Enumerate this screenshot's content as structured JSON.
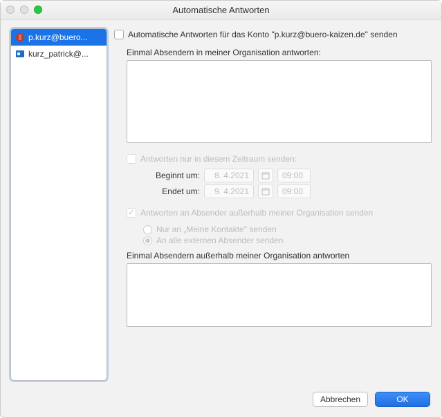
{
  "window": {
    "title": "Automatische Antworten"
  },
  "accounts": [
    {
      "label": "p.kurz@buero...",
      "icon": "outlook-badge-red",
      "selected": true
    },
    {
      "label": "kurz_patrick@...",
      "icon": "outlook-badge-blue",
      "selected": false
    }
  ],
  "send_checkbox_label": "Automatische Antworten für das Konto \"p.kurz@buero-kaizen.de\" senden",
  "internal": {
    "label": "Einmal Absendern in meiner Organisation antworten:",
    "body": ""
  },
  "time": {
    "only_in_range_label": "Antworten nur in diesem Zeitraum senden:",
    "begin_label": "Beginnt um:",
    "end_label": "Endet um:",
    "begin_date": "8.  4.2021",
    "begin_time": "09:00",
    "end_date": "9.  4.2021",
    "end_time": "09:00"
  },
  "external": {
    "send_label": "Antworten an Absender außerhalb meiner Organisation senden",
    "radio_contacts": "Nur an „Meine Kontakte\" senden",
    "radio_all": "An alle externen Absender senden",
    "body_label": "Einmal Absendern außerhalb meiner Organisation antworten",
    "body": ""
  },
  "footer": {
    "cancel": "Abbrechen",
    "ok": "OK"
  }
}
